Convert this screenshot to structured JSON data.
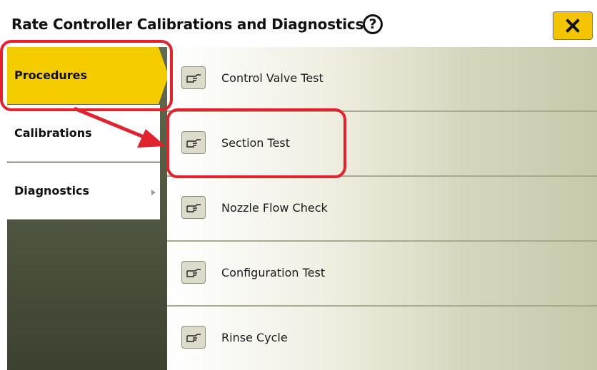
{
  "header": {
    "title": "Rate Controller Calibrations and Diagnostics",
    "help_glyph": "?",
    "close_icon": "close-x-icon"
  },
  "sidebar": {
    "items": [
      {
        "label": "Procedures",
        "active": true
      },
      {
        "label": "Calibrations",
        "active": false
      },
      {
        "label": "Diagnostics",
        "active": false,
        "has_submenu": true
      }
    ]
  },
  "procedures": {
    "items": [
      {
        "label": "Control Valve Test",
        "icon": "hand-pointer-icon"
      },
      {
        "label": "Section Test",
        "icon": "hand-pointer-icon",
        "highlighted": true
      },
      {
        "label": "Nozzle Flow Check",
        "icon": "hand-pointer-icon"
      },
      {
        "label": "Configuration Test",
        "icon": "hand-pointer-icon"
      },
      {
        "label": "Rinse Cycle",
        "icon": "hand-pointer-icon"
      }
    ]
  },
  "colors": {
    "accent": "#f4cc00",
    "annotation": "#e0232e",
    "sidebar_bg": "#4f5640"
  }
}
